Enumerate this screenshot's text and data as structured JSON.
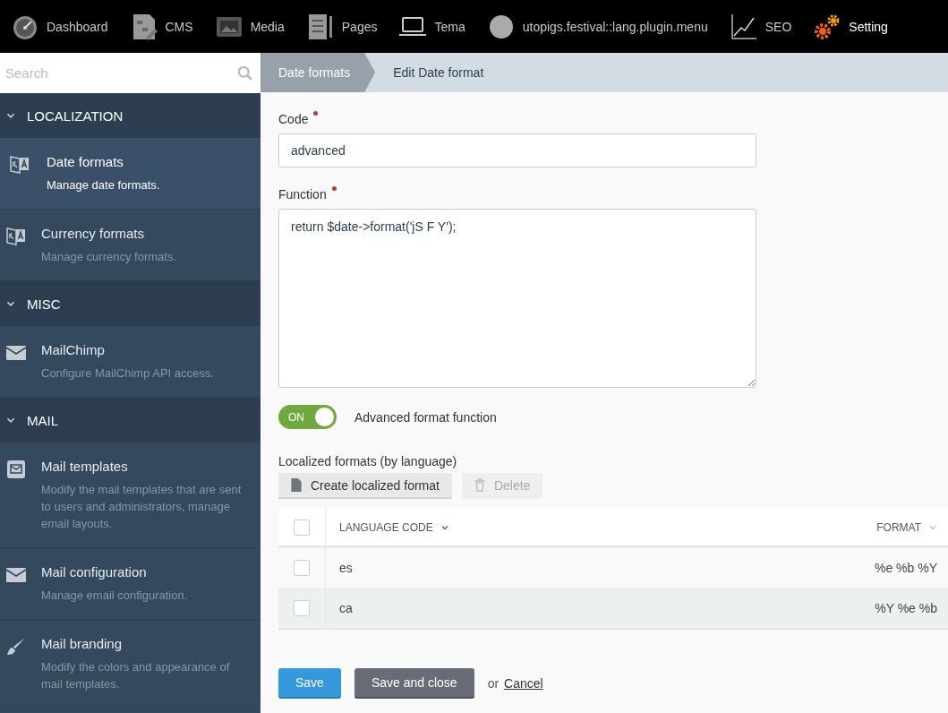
{
  "topnav": [
    {
      "kind": "dashboard",
      "label": "Dashboard",
      "selected": false
    },
    {
      "kind": "cms",
      "label": "CMS",
      "selected": false
    },
    {
      "kind": "media",
      "label": "Media",
      "selected": false
    },
    {
      "kind": "pages",
      "label": "Pages",
      "selected": false
    },
    {
      "kind": "laptop",
      "label": "Tema",
      "selected": false
    },
    {
      "kind": "circle",
      "label": "utopigs.festival::lang.plugin.menu",
      "selected": false
    },
    {
      "kind": "seo",
      "label": "SEO",
      "selected": false
    },
    {
      "kind": "settings",
      "label": "Setting",
      "selected": true
    }
  ],
  "search": {
    "placeholder": "Search"
  },
  "sidebar": [
    {
      "title": "LOCALIZATION",
      "expanded": true,
      "items": [
        {
          "kind": "translate",
          "label": "Date formats",
          "description": "Manage date formats.",
          "selected": true
        },
        {
          "kind": "translate",
          "label": "Currency formats",
          "description": "Manage currency formats.",
          "selected": false
        }
      ]
    },
    {
      "title": "MISC",
      "expanded": true,
      "items": [
        {
          "kind": "mail",
          "label": "MailChimp",
          "description": "Configure MailChimp API access.",
          "selected": false
        }
      ]
    },
    {
      "title": "MAIL",
      "expanded": true,
      "items": [
        {
          "kind": "template",
          "label": "Mail templates",
          "description": "Modify the mail templates that are sent to users and administrators, manage email layouts.",
          "selected": false
        },
        {
          "kind": "mail",
          "label": "Mail configuration",
          "description": "Manage email configuration.",
          "selected": false
        },
        {
          "kind": "brush",
          "label": "Mail branding",
          "description": "Modify the colors and appearance of mail templates.",
          "selected": false
        }
      ]
    }
  ],
  "breadcrumbs": [
    "Date formats",
    "Edit Date format"
  ],
  "form": {
    "code": {
      "label": "Code",
      "required": true,
      "value": "advanced"
    },
    "function": {
      "label": "Function",
      "required": true,
      "value": "return $date->format('jS F Y');"
    },
    "toggle": {
      "on": true,
      "state_text": "ON",
      "label": "Advanced format function"
    }
  },
  "localized": {
    "title": "Localized formats (by language)",
    "toolbar": [
      {
        "kind": "create",
        "label": "Create localized format",
        "disabled": false
      },
      {
        "kind": "delete",
        "label": "Delete",
        "disabled": true
      }
    ],
    "select_all_checked": false,
    "columns": [
      {
        "label": "LANGUAGE CODE",
        "sorted": true
      },
      {
        "label": "FORMAT",
        "sorted": false
      }
    ],
    "rows": [
      {
        "checked": false,
        "hover": false,
        "cells": [
          "es",
          "%e %b %Y"
        ]
      },
      {
        "checked": false,
        "hover": true,
        "cells": [
          "ca",
          "%Y %e %b"
        ]
      }
    ]
  },
  "actions": {
    "save": "Save",
    "save_close": "Save and close",
    "or": "or",
    "cancel": "Cancel"
  }
}
